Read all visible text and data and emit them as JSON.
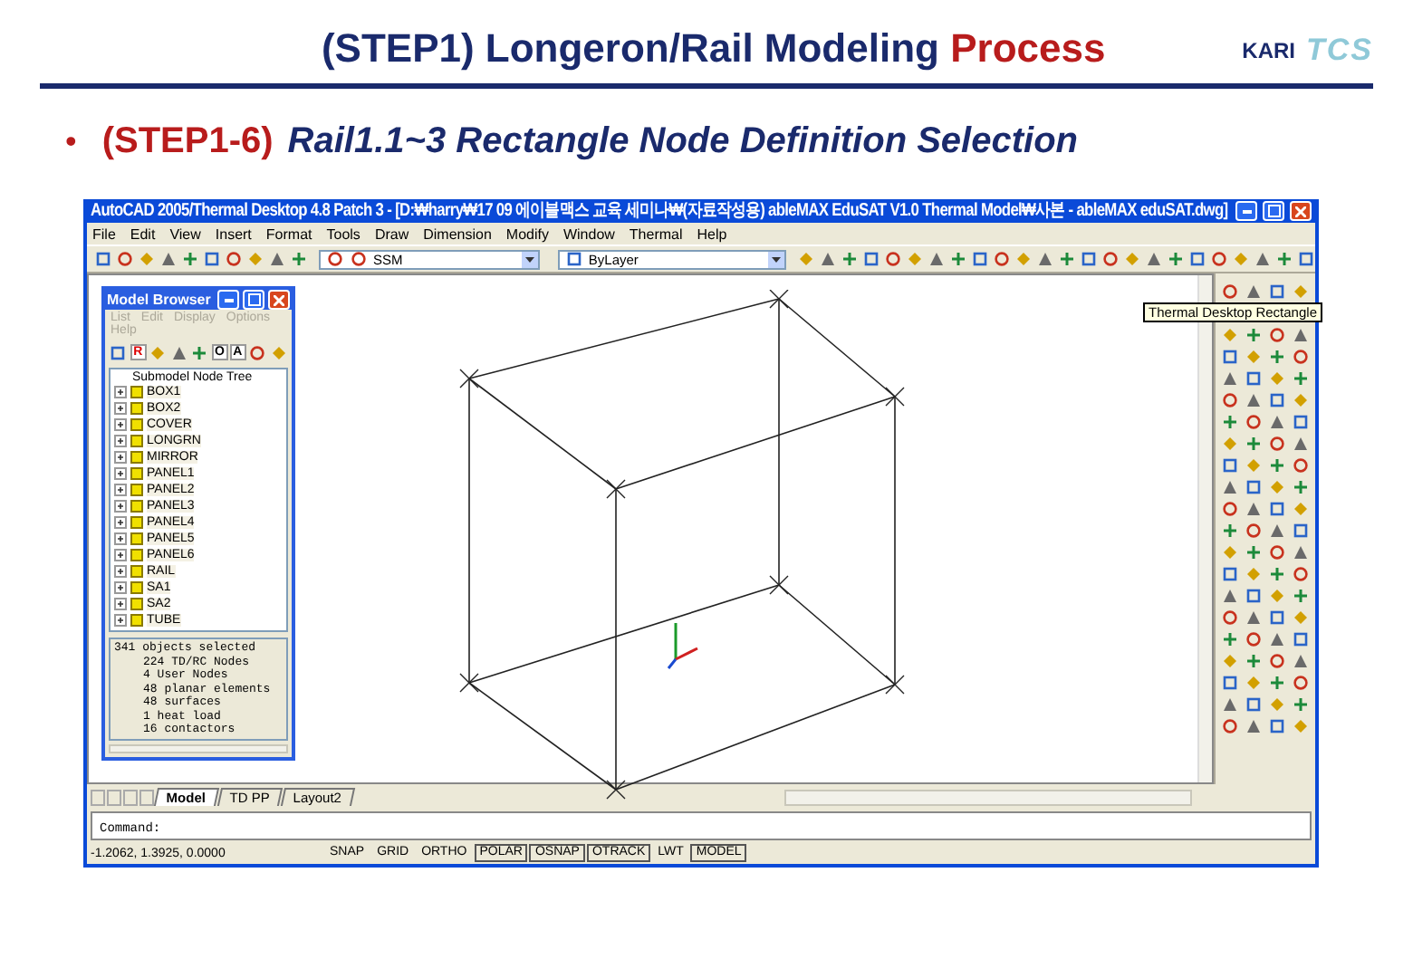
{
  "slide": {
    "title": "(STEP1) Longeron/Rail Modeling",
    "title_highlight": "Process",
    "logos": [
      "KARI",
      "TCS"
    ]
  },
  "bullet": {
    "marker": "•",
    "step": "(STEP1-6)",
    "text": "Rail1.1~3 Rectangle Node Definition Selection"
  },
  "window": {
    "title": "AutoCAD 2005/Thermal Desktop 4.8 Patch 3 - [D:₩harry₩17 09 에이블맥스 교육 세미나₩(자료작성용) ableMAX EduSAT V1.0 Thermal Model₩사본 - ableMAX eduSAT.dwg]",
    "menu": [
      "File",
      "Edit",
      "View",
      "Insert",
      "Format",
      "Tools",
      "Draw",
      "Dimension",
      "Modify",
      "Window",
      "Thermal",
      "Help"
    ],
    "layer": "SSM",
    "linetype": "ByLayer",
    "model_browser": {
      "title": "Model Browser",
      "menu": [
        {
          "label": "List",
          "disabled": true
        },
        {
          "label": "Edit",
          "disabled": true
        },
        {
          "label": "Display",
          "disabled": true
        },
        {
          "label": "Options",
          "disabled": true
        },
        {
          "label": "Help",
          "disabled": true
        }
      ],
      "toolbar_letters": [
        "R",
        "O",
        "A"
      ],
      "tree_title": "Submodel Node Tree",
      "tree": [
        {
          "label": "BOX1",
          "expanded": false
        },
        {
          "label": "BOX2",
          "expanded": false
        },
        {
          "label": "COVER",
          "expanded": false
        },
        {
          "label": "LONGRN",
          "expanded": false
        },
        {
          "label": "MIRROR",
          "expanded": false
        },
        {
          "label": "PANEL1",
          "expanded": false
        },
        {
          "label": "PANEL2",
          "expanded": false
        },
        {
          "label": "PANEL3",
          "expanded": false
        },
        {
          "label": "PANEL4",
          "expanded": false
        },
        {
          "label": "PANEL5",
          "expanded": false
        },
        {
          "label": "PANEL6",
          "expanded": false
        },
        {
          "label": "RAIL",
          "expanded": false
        },
        {
          "label": "SA1",
          "expanded": false
        },
        {
          "label": "SA2",
          "expanded": false
        },
        {
          "label": "TUBE",
          "expanded": false
        }
      ],
      "summary_header": "341 objects selected",
      "summary": [
        "224 TD/RC Nodes",
        "4 User Nodes",
        "48 planar elements",
        "48 surfaces",
        "1 heat load",
        "16 contactors"
      ]
    },
    "tooltip": "Thermal Desktop Rectangle",
    "layout_tabs": [
      {
        "label": "Model",
        "selected": true
      },
      {
        "label": "TD PP",
        "selected": false
      },
      {
        "label": "Layout2",
        "selected": false
      }
    ],
    "command": "Command:",
    "coordinates": "-1.2062, 1.3925, 0.0000",
    "status_buttons": [
      {
        "label": "SNAP",
        "on": false
      },
      {
        "label": "GRID",
        "on": false
      },
      {
        "label": "ORTHO",
        "on": false
      },
      {
        "label": "POLAR",
        "on": true
      },
      {
        "label": "OSNAP",
        "on": true
      },
      {
        "label": "OTRACK",
        "on": true
      },
      {
        "label": "LWT",
        "on": false
      },
      {
        "label": "MODEL",
        "on": true
      }
    ]
  }
}
